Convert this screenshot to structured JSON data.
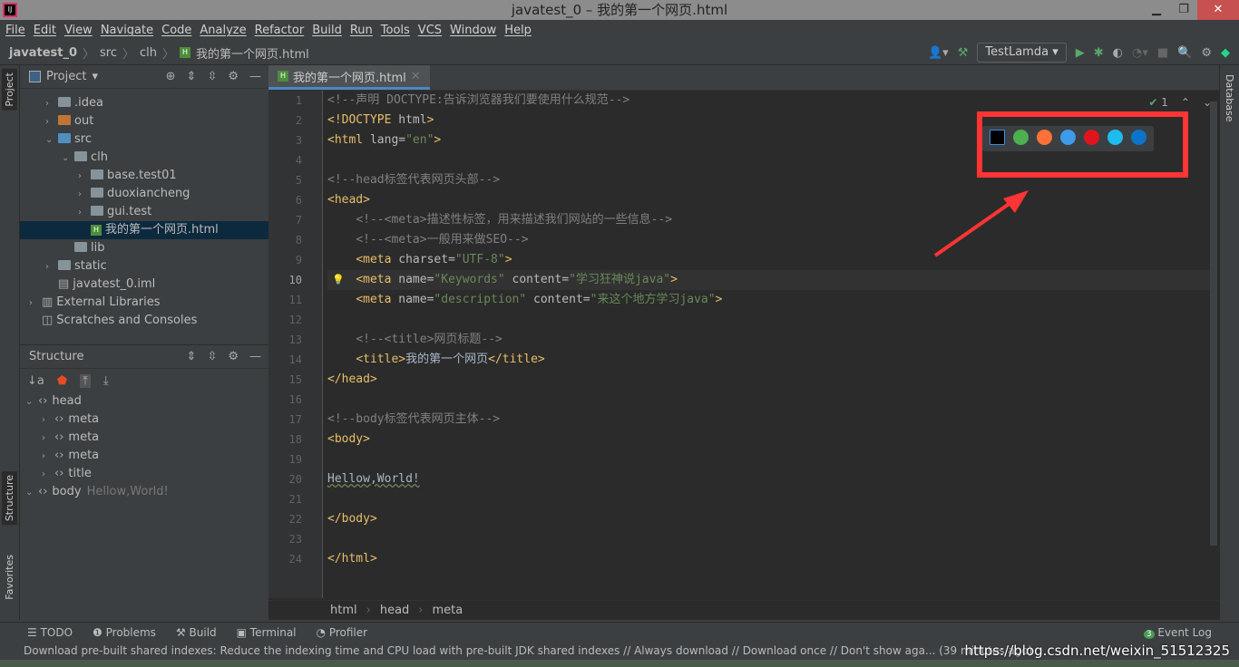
{
  "window": {
    "title": "javatest_0 – 我的第一个网页.html",
    "min": "▁",
    "restore": "❐",
    "close": "✕"
  },
  "menu": [
    "File",
    "Edit",
    "View",
    "Navigate",
    "Code",
    "Analyze",
    "Refactor",
    "Build",
    "Run",
    "Tools",
    "VCS",
    "Window",
    "Help"
  ],
  "breadcrumb": [
    "javatest_0",
    "src",
    "clh",
    "我的第一个网页.html"
  ],
  "toolbar": {
    "run_config": "TestLamda"
  },
  "left_tabs": {
    "project": "Project",
    "structure": "Structure",
    "favorites": "Favorites"
  },
  "project": {
    "title": "Project",
    "tree": [
      {
        "label": ".idea",
        "depth": 1,
        "arrow": "›",
        "icon": "folder"
      },
      {
        "label": "out",
        "depth": 1,
        "arrow": "›",
        "icon": "folder-orange"
      },
      {
        "label": "src",
        "depth": 1,
        "arrow": "⌄",
        "icon": "folder-blue"
      },
      {
        "label": "clh",
        "depth": 2,
        "arrow": "⌄",
        "icon": "folder"
      },
      {
        "label": "base.test01",
        "depth": 3,
        "arrow": "›",
        "icon": "folder"
      },
      {
        "label": "duoxiancheng",
        "depth": 3,
        "arrow": "›",
        "icon": "folder"
      },
      {
        "label": "gui.test",
        "depth": 3,
        "arrow": "›",
        "icon": "folder"
      },
      {
        "label": "我的第一个网页.html",
        "depth": 3,
        "arrow": "",
        "icon": "html-file",
        "selected": true
      },
      {
        "label": "lib",
        "depth": 2,
        "arrow": "",
        "icon": "folder"
      },
      {
        "label": "static",
        "depth": 1,
        "arrow": "›",
        "icon": "folder"
      },
      {
        "label": "javatest_0.iml",
        "depth": 1,
        "arrow": "",
        "icon": "iml-file"
      },
      {
        "label": "External Libraries",
        "depth": 0,
        "arrow": "›",
        "icon": "library"
      },
      {
        "label": "Scratches and Consoles",
        "depth": 0,
        "arrow": "",
        "icon": "scratches"
      }
    ]
  },
  "structure": {
    "title": "Structure",
    "tree": [
      {
        "label": "head",
        "depth": 0,
        "arrow": "⌄",
        "extra": ""
      },
      {
        "label": "meta",
        "depth": 1,
        "arrow": "›",
        "extra": ""
      },
      {
        "label": "meta",
        "depth": 1,
        "arrow": "›",
        "extra": ""
      },
      {
        "label": "meta",
        "depth": 1,
        "arrow": "›",
        "extra": ""
      },
      {
        "label": "title",
        "depth": 1,
        "arrow": "›",
        "extra": ""
      },
      {
        "label": "body",
        "depth": 0,
        "arrow": "⌄",
        "extra": "Hellow,World!"
      }
    ]
  },
  "editor": {
    "tab": "我的第一个网页.html",
    "inspections": "1",
    "current_line": 10,
    "lines": [
      [
        [
          "c",
          "<!--声明 DOCTYPE:告诉浏览器我们要使用什么规范-->"
        ]
      ],
      [
        [
          "t",
          "<!DOCTYPE "
        ],
        [
          "a",
          "html"
        ],
        [
          "t",
          ">"
        ]
      ],
      [
        [
          "t",
          "<html "
        ],
        [
          "a",
          "lang="
        ],
        [
          "v",
          "\"en\""
        ],
        [
          "t",
          ">"
        ]
      ],
      [],
      [
        [
          "c",
          "<!--head标签代表网页头部-->"
        ]
      ],
      [
        [
          "t",
          "<head>"
        ]
      ],
      [
        [
          "p",
          "    "
        ],
        [
          "c",
          "<!--<meta>描述性标签，用来描述我们网站的一些信息-->"
        ]
      ],
      [
        [
          "p",
          "    "
        ],
        [
          "c",
          "<!--<meta>一般用来做SEO-->"
        ]
      ],
      [
        [
          "p",
          "    "
        ],
        [
          "t",
          "<meta "
        ],
        [
          "a",
          "charset="
        ],
        [
          "v",
          "\"UTF-8\""
        ],
        [
          "t",
          ">"
        ]
      ],
      [
        [
          "p",
          "    "
        ],
        [
          "t",
          "<meta "
        ],
        [
          "a",
          "name="
        ],
        [
          "v",
          "\"Keywords\""
        ],
        [
          "a",
          " content="
        ],
        [
          "v",
          "\"学习狂神说java\""
        ],
        [
          "t",
          ">"
        ]
      ],
      [
        [
          "p",
          "    "
        ],
        [
          "t",
          "<meta "
        ],
        [
          "a",
          "name="
        ],
        [
          "v",
          "\"description\""
        ],
        [
          "a",
          " content="
        ],
        [
          "v",
          "\"来这个地方学习java\""
        ],
        [
          "t",
          ">"
        ]
      ],
      [],
      [
        [
          "p",
          "    "
        ],
        [
          "c",
          "<!--<title>网页标题-->"
        ]
      ],
      [
        [
          "p",
          "    "
        ],
        [
          "t",
          "<title>"
        ],
        [
          "p",
          "我的第一个网页"
        ],
        [
          "t",
          "</title>"
        ]
      ],
      [
        [
          "t",
          "</head>"
        ]
      ],
      [],
      [
        [
          "c",
          "<!--body标签代表网页主体-->"
        ]
      ],
      [
        [
          "t",
          "<body>"
        ]
      ],
      [],
      [
        [
          "w",
          "Hellow,World!"
        ]
      ],
      [],
      [
        [
          "t",
          "</body>"
        ]
      ],
      [],
      [
        [
          "t",
          "</html>"
        ]
      ]
    ],
    "browsers": [
      {
        "name": "intellij",
        "color": "#000000"
      },
      {
        "name": "chrome",
        "color": "#4caf50"
      },
      {
        "name": "firefox",
        "color": "#ff7139"
      },
      {
        "name": "safari",
        "color": "#3d9be9"
      },
      {
        "name": "opera",
        "color": "#e0141e"
      },
      {
        "name": "internet-explorer",
        "color": "#1ebbee"
      },
      {
        "name": "edge",
        "color": "#0c74c8"
      }
    ]
  },
  "editor_breadcrumb": [
    "html",
    "head",
    "meta"
  ],
  "right_tabs": {
    "database": "Database"
  },
  "bottom_tools": [
    "TODO",
    "Problems",
    "Build",
    "Terminal",
    "Profiler"
  ],
  "event_log": {
    "label": "Event Log",
    "count": "3"
  },
  "status": "Download pre-built shared indexes: Reduce the indexing time and CPU load with pre-built JDK shared indexes // Always download // Download once // Don't show aga... (39 minutes ago)",
  "watermark": "https://blog.csdn.net/weixin_51512325",
  "colors": {
    "annotation": "#ff3434",
    "accent": "#4a88c7"
  }
}
